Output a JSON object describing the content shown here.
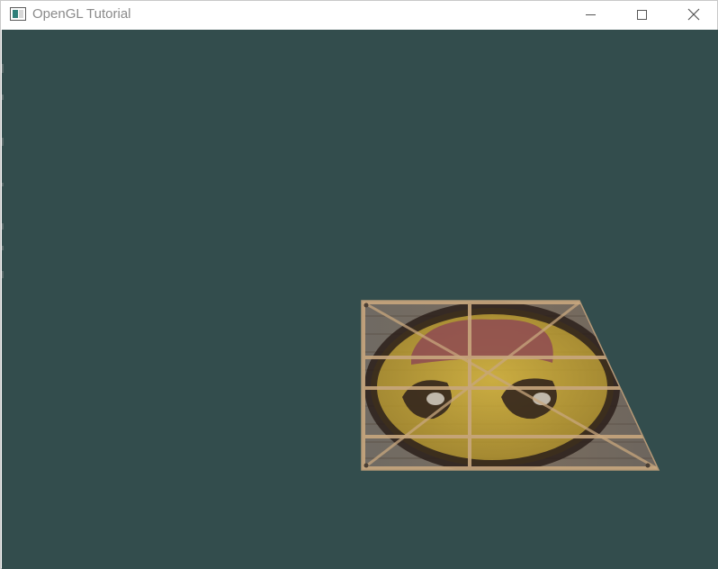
{
  "window": {
    "title": "OpenGL Tutorial",
    "app_icon": "opengl-window-icon",
    "controls": {
      "minimize_icon": "minimize-icon",
      "maximize_icon": "maximize-icon",
      "close_icon": "close-icon"
    }
  },
  "viewport": {
    "clear_color": "#334d4d",
    "object": "textured-quad",
    "texture_1": "wooden-crate",
    "texture_2": "awesomeface"
  },
  "colors": {
    "background": "#334d4d",
    "wood": "#7a6a5a",
    "face_yellow": "#c9a62a",
    "face_dark": "#2b1f1b",
    "face_red": "#8e4a52"
  }
}
